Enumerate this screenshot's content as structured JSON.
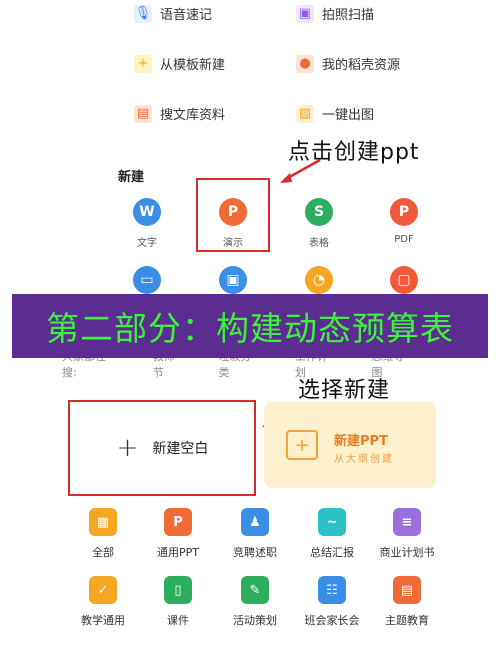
{
  "top_items": [
    {
      "label": "语音速记",
      "icon": "microphone-icon",
      "color": "#3b82f6"
    },
    {
      "label": "拍照扫描",
      "icon": "scan-icon",
      "color": "#8b5cf6"
    },
    {
      "label": "从模板新建",
      "icon": "template-icon",
      "color": "#f5b400"
    },
    {
      "label": "我的稻壳资源",
      "icon": "user-icon",
      "color": "#f06a35"
    },
    {
      "label": "搜文库资料",
      "icon": "library-icon",
      "color": "#f06a35"
    },
    {
      "label": "一键出图",
      "icon": "image-icon",
      "color": "#f5a623"
    }
  ],
  "annotations": {
    "click_ppt": "点击创建ppt",
    "choose_new": "选择新建"
  },
  "section": {
    "title": "新建"
  },
  "create_items": [
    {
      "label": "文字",
      "glyph": "W",
      "icon": "word-icon",
      "color": "#3a8ee6"
    },
    {
      "label": "演示",
      "glyph": "P",
      "icon": "presentation-icon",
      "color": "#f06a35"
    },
    {
      "label": "表格",
      "glyph": "S",
      "icon": "spreadsheet-icon",
      "color": "#2dae5c"
    },
    {
      "label": "PDF",
      "glyph": "P",
      "icon": "pdf-icon",
      "color": "#f05a3a"
    }
  ],
  "create_row2": [
    {
      "icon": "form-icon",
      "color": "#3a8ee6"
    },
    {
      "icon": "contact-icon",
      "color": "#3a8ee6"
    },
    {
      "icon": "chart-icon",
      "color": "#f5a623"
    },
    {
      "icon": "doc-lock-icon",
      "color": "#f05a3a"
    }
  ],
  "banner": {
    "text": "第二部分：构建动态预算表"
  },
  "search_hints": [
    "大家都在搜:",
    "教师节",
    "垃圾分类",
    "工作计划",
    "思维导图"
  ],
  "blank": {
    "label": "新建空白",
    "plus": "+"
  },
  "outline": {
    "title": "新建PPT",
    "subtitle": "从大纲创建"
  },
  "templates_row1": [
    {
      "label": "全部",
      "icon": "grid-icon",
      "color": "#f5a623",
      "glyph": "▦"
    },
    {
      "label": "通用PPT",
      "icon": "ppt-icon",
      "color": "#f06a35",
      "glyph": "P"
    },
    {
      "label": "竞聘述职",
      "icon": "person-icon",
      "color": "#3a8ee6",
      "glyph": "♟"
    },
    {
      "label": "总结汇报",
      "icon": "report-icon",
      "color": "#2cc0c8",
      "glyph": "~"
    },
    {
      "label": "商业计划书",
      "icon": "book-icon",
      "color": "#9b6fe0",
      "glyph": "≡"
    }
  ],
  "templates_row2": [
    {
      "label": "教学通用",
      "icon": "teach-icon",
      "color": "#f5a623",
      "glyph": "✓"
    },
    {
      "label": "课件",
      "icon": "courseware-icon",
      "color": "#2dae5c",
      "glyph": "▯"
    },
    {
      "label": "活动策划",
      "icon": "plan-icon",
      "color": "#2dae5c",
      "glyph": "✎"
    },
    {
      "label": "班会家长会",
      "icon": "meeting-icon",
      "color": "#3a8ee6",
      "glyph": "☷"
    },
    {
      "label": "主题教育",
      "icon": "theme-icon",
      "color": "#f06a35",
      "glyph": "▤"
    }
  ]
}
